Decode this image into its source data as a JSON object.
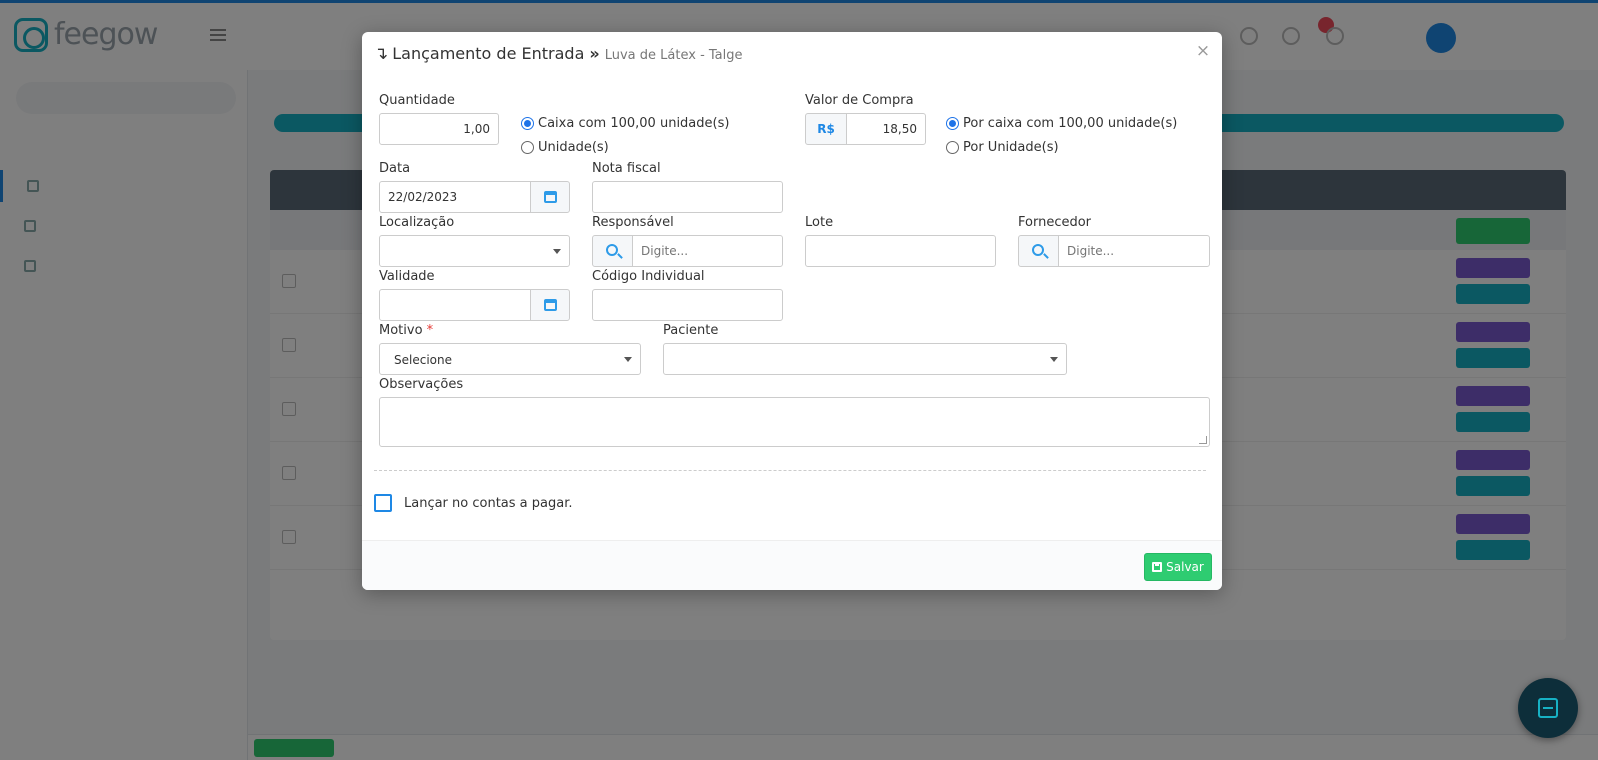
{
  "modal": {
    "title_arrow": "↴",
    "title": "Lançamento de Entrada",
    "title_separator": "»",
    "subtitle": "Luva de Látex - Talge",
    "close_glyph": "×",
    "quantidade": {
      "label": "Quantidade",
      "value": "1,00"
    },
    "unit_options": [
      {
        "label": "Caixa com 100,00 unidade(s)",
        "checked": true
      },
      {
        "label": "Unidade(s)",
        "checked": false
      }
    ],
    "valor_compra": {
      "label": "Valor de Compra",
      "prefix": "R$",
      "value": "18,50"
    },
    "price_options": [
      {
        "label": "Por caixa com 100,00 unidade(s)",
        "checked": true
      },
      {
        "label": "Por Unidade(s)",
        "checked": false
      }
    ],
    "data": {
      "label": "Data",
      "value": "22/02/2023"
    },
    "nota_fiscal": {
      "label": "Nota fiscal",
      "value": ""
    },
    "localizacao": {
      "label": "Localização",
      "value": ""
    },
    "responsavel": {
      "label": "Responsável",
      "placeholder": "Digite..."
    },
    "lote": {
      "label": "Lote",
      "value": ""
    },
    "fornecedor": {
      "label": "Fornecedor",
      "placeholder": "Digite..."
    },
    "validade": {
      "label": "Validade",
      "value": ""
    },
    "codigo_individual": {
      "label": "Código Individual",
      "value": ""
    },
    "motivo": {
      "label": "Motivo",
      "required_mark": "*",
      "value": "Selecione"
    },
    "paciente": {
      "label": "Paciente",
      "value": ""
    },
    "observacoes": {
      "label": "Observações",
      "value": ""
    },
    "contas_pagar": {
      "label": "Lançar no contas a pagar.",
      "checked": false
    },
    "save_label": "Salvar"
  },
  "colors": {
    "primary": "#1e88e5",
    "success": "#2ecc71",
    "required": "#e53935"
  }
}
